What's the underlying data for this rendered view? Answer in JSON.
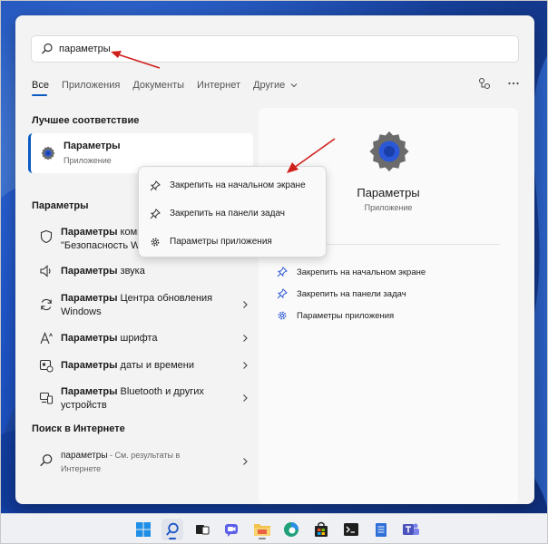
{
  "search": {
    "query": "параметры"
  },
  "tabs": [
    {
      "label": "Все"
    },
    {
      "label": "Приложения"
    },
    {
      "label": "Документы"
    },
    {
      "label": "Интернет"
    },
    {
      "label": "Другие"
    }
  ],
  "best_match": {
    "header": "Лучшее соответствие",
    "title": "Параметры",
    "subtitle": "Приложение"
  },
  "settings_section": {
    "header": "Параметры",
    "items": [
      {
        "bold": "Параметры",
        "rest": " компьютера: \"Безопасность Windows\"",
        "line1_bold": "Параметры",
        "line1_rest": " компь",
        "line2": "\"Безопасность Wi"
      },
      {
        "bold": "Параметры",
        "rest": " звука",
        "line1_bold": "Параметры",
        "line1_rest": " звука",
        "line2": ""
      },
      {
        "bold": "Параметры",
        "line1_bold": "Параметры",
        "line1_rest": " Центра обновления",
        "line2": "Windows"
      },
      {
        "bold": "Параметры",
        "line1_bold": "Параметры",
        "line1_rest": " шрифта",
        "line2": ""
      },
      {
        "bold": "Параметры",
        "line1_bold": "Параметры",
        "line1_rest": " даты и времени",
        "line2": ""
      },
      {
        "bold": "Параметры",
        "line1_bold": "Параметры",
        "line1_rest": " Bluetooth и других",
        "line2": "устройств"
      }
    ]
  },
  "web_section": {
    "header": "Поиск в Интернете",
    "query": "параметры",
    "hint_line1": " - См. результаты в",
    "hint_line2": "Интернете"
  },
  "context_menu": {
    "items": [
      {
        "label": "Закрепить на начальном экране"
      },
      {
        "label": "Закрепить на панели задач"
      },
      {
        "label": "Параметры приложения"
      }
    ]
  },
  "preview": {
    "title": "Параметры",
    "subtitle": "Приложение",
    "actions": [
      {
        "label": "Закрепить на начальном экране"
      },
      {
        "label": "Закрепить на панели задач"
      },
      {
        "label": "Параметры приложения"
      }
    ]
  },
  "colors": {
    "accent": "#0a5bc4",
    "annotation_arrow": "#d0201c",
    "panel": "#f3f3f3"
  },
  "taskbar": {
    "icons": [
      "windows-start-icon",
      "search-icon",
      "task-view-icon",
      "chat-icon",
      "file-explorer-icon",
      "edge-icon",
      "store-icon",
      "terminal-icon",
      "notepad-icon",
      "teams-icon"
    ]
  }
}
